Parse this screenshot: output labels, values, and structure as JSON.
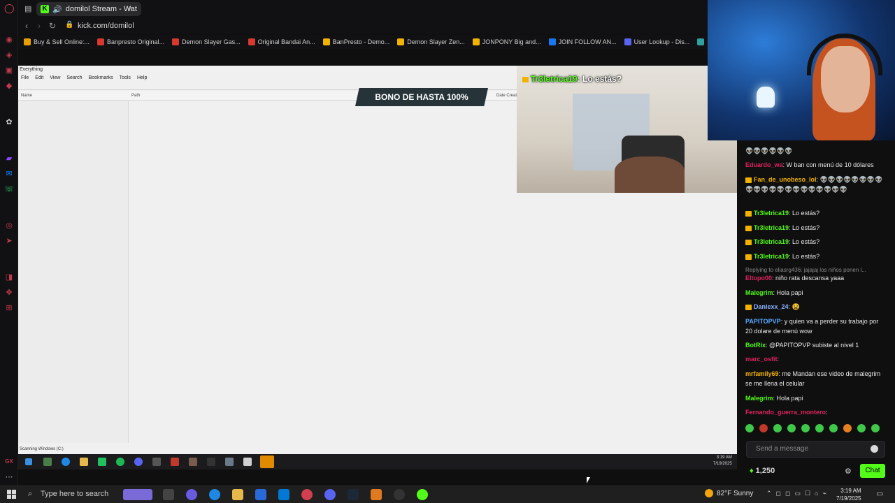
{
  "browser": {
    "tab_title": "domilol Stream - Wat",
    "url": "kick.com/domilol",
    "bookmarks": [
      {
        "label": "Buy & Sell Online:...",
        "color": "#e8a000"
      },
      {
        "label": "Banpresto Original...",
        "color": "#d7392e"
      },
      {
        "label": "Demon Slayer Gas...",
        "color": "#d7392e"
      },
      {
        "label": "Original Bandai An...",
        "color": "#d7392e"
      },
      {
        "label": "BanPresto - Demo...",
        "color": "#f2b200"
      },
      {
        "label": "Demon Slayer Zen...",
        "color": "#f2b200"
      },
      {
        "label": "JONPONY Big and...",
        "color": "#f2b200"
      },
      {
        "label": "JOIN FOLLOW AN...",
        "color": "#1877f2"
      },
      {
        "label": "User Lookup - Dis...",
        "color": "#5865f2"
      },
      {
        "label": "Stocking &",
        "color": "#2ea0a0"
      }
    ]
  },
  "stream": {
    "everything_window": {
      "title": "Everything",
      "menu": [
        "File",
        "Edit",
        "View",
        "Search",
        "Bookmarks",
        "Tools",
        "Help"
      ],
      "columns": [
        "Name",
        "Path",
        "Date Creat"
      ],
      "status": "Scanning Windows (C:)"
    },
    "banner": "BONO DE HASTA 100%",
    "cam_chat": {
      "name": "Tr3letrica19",
      "text": ": Lo estás?"
    },
    "clock": {
      "time": "3:19 AM",
      "date": "7/19/2025"
    }
  },
  "chat": {
    "messages": [
      {
        "name": "",
        "text": "👽👽👽👽👽👽",
        "color": "#e8e8e8",
        "top": 0
      },
      {
        "name": "Eduardo_wa",
        "text": ": W ban con menú de 10 dólares",
        "color": "#e0245e",
        "badge": false
      },
      {
        "name": "Fan_de_unobeso_lol",
        "text": ": 👽👽👽👽👽👽👽👽👽👽👽👽👽👽👽👽👽👽👽👽👽",
        "color": "#f2b200",
        "badge": true
      },
      {
        "name": "Tr3letrica19",
        "text": ": Lo estás?",
        "color": "#53fc18",
        "badge": true
      },
      {
        "name": "Tr3letrica19",
        "text": ": Lo estás?",
        "color": "#53fc18",
        "badge": true
      },
      {
        "name": "Tr3letrica19",
        "text": ": Lo estás?",
        "color": "#53fc18",
        "badge": true
      },
      {
        "name": "Tr3letrica19",
        "text": ": Lo estás?",
        "color": "#53fc18",
        "badge": true
      },
      {
        "reply": "Replying to eliasrg436: jajajaj los niños ponen l..."
      },
      {
        "name": "Eltopo00",
        "text": ": niño rata descansa yaaa",
        "color": "#e0245e",
        "badge": false
      },
      {
        "name": "Malegrim",
        "text": ": Hola papi",
        "color": "#53fc18",
        "badge": false
      },
      {
        "name": "Daniexx_24",
        "text": ": 😫",
        "color": "#8ab4ff",
        "badge": true
      },
      {
        "name": "PAPITOPVP",
        "text": ": y quien va a perder su trabajo por 20 dolare de menú wow",
        "color": "#5aa9ff",
        "badge": false
      },
      {
        "name": "BotRix",
        "text": ": @PAPITOPVP subiste al nivel 1",
        "color": "#53fc18",
        "badge": false
      },
      {
        "name": "marc_osfit",
        "text": ":",
        "color": "#e0245e",
        "badge": false
      },
      {
        "name": "mrfamily69",
        "text": ": me Mandan ese video de malegrim se me llena el celular",
        "color": "#f2b200",
        "badge": false
      },
      {
        "name": "Malegrim",
        "text": ": Hola papi",
        "color": "#53fc18",
        "badge": false
      },
      {
        "name": "Fernando_guerra_montero",
        "text": ":",
        "color": "#e0245e",
        "badge": false
      }
    ],
    "input_placeholder": "Send a message",
    "points": "1,250",
    "chat_button": "Chat"
  },
  "taskbar": {
    "search_placeholder": "Type here to search",
    "weather": "82°F  Sunny",
    "time": "3:19 AM",
    "date": "7/19/2025"
  }
}
